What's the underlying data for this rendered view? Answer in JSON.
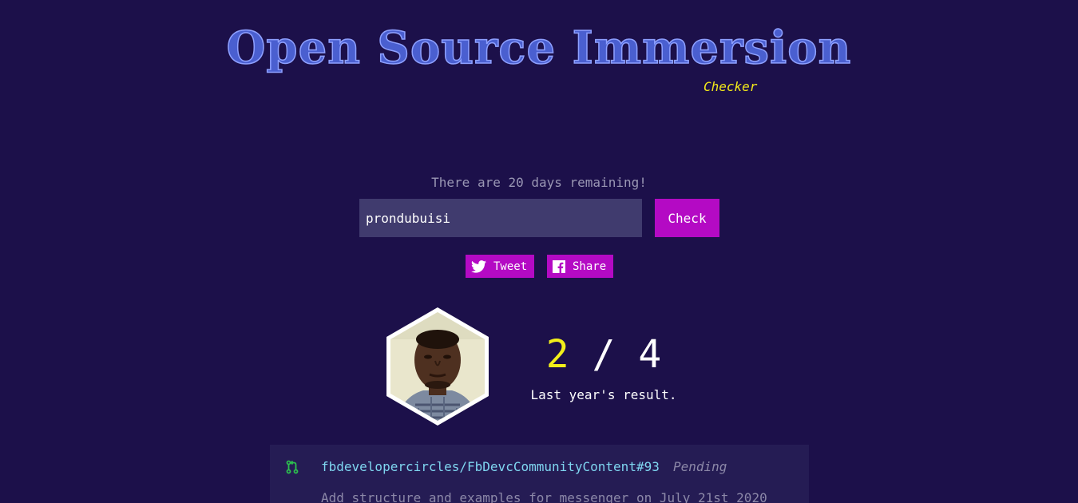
{
  "header": {
    "title": "Open Source Immersion",
    "subtitle": "Checker"
  },
  "status": {
    "days_remaining_text": "There are 20 days remaining!"
  },
  "search": {
    "value": "prondubuisi",
    "button_label": "Check"
  },
  "social": {
    "tweet_label": "Tweet",
    "share_label": "Share",
    "tweet_icon": "twitter-icon",
    "share_icon": "facebook-icon"
  },
  "profile": {
    "avatar_icon": "avatar-photo"
  },
  "result": {
    "current": "2",
    "separator": " / ",
    "total": "4",
    "caption": "Last year's result."
  },
  "pull_requests": [
    {
      "icon": "pull-request-icon",
      "repo_link": "fbdevelopercircles/FbDevcCommunityContent#93",
      "status": "Pending",
      "description": "Add structure and examples for messenger on July 21st 2020"
    }
  ],
  "colors": {
    "background": "#1c104a",
    "accent": "#b40ac4",
    "title": "#4a5fd0",
    "subtitle": "#f2e81a",
    "score_highlight": "#f2ef1a",
    "link": "#7fd6f0",
    "card": "#251c54",
    "input": "#403b6e"
  }
}
